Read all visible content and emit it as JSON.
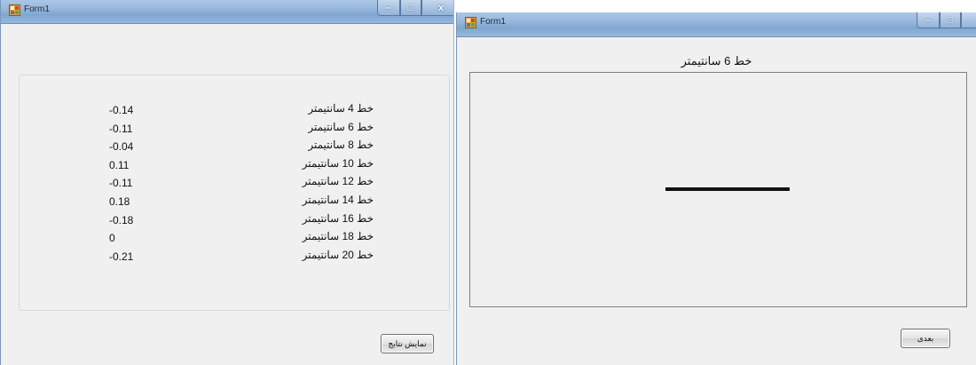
{
  "left_window": {
    "title": "Form1",
    "caption_buttons": {
      "minimize": "–",
      "maximize": "□",
      "close": "x"
    },
    "results": [
      {
        "label": "خط 4 سانتیمتر",
        "value": "-0.14"
      },
      {
        "label": "خط 6 سانتیمتر",
        "value": "-0.11"
      },
      {
        "label": "خط 8 سانتیمتر",
        "value": "-0.04"
      },
      {
        "label": "خط 10 سانتیمتر",
        "value": "0.11"
      },
      {
        "label": "خط 12 سانتیمتر",
        "value": "-0.11"
      },
      {
        "label": "خط 14 سانتیمتر",
        "value": "0.18"
      },
      {
        "label": "خط 16 سانتیمتر",
        "value": "-0.18"
      },
      {
        "label": "خط 18 سانتیمتر",
        "value": "0"
      },
      {
        "label": "خط 20 سانتیمتر",
        "value": "-0.21"
      }
    ],
    "show_results_button": "نمایش نتایج"
  },
  "right_window": {
    "title": "Form1",
    "caption_buttons": {
      "minimize": "–",
      "maximize": "□",
      "close": "x"
    },
    "heading": "خط 6 سانتیمتر",
    "next_button": "بعدی"
  },
  "colors": {
    "titlebar": "#9ab9dd",
    "window_bg": "#f0f0f0",
    "line": "#111111"
  }
}
